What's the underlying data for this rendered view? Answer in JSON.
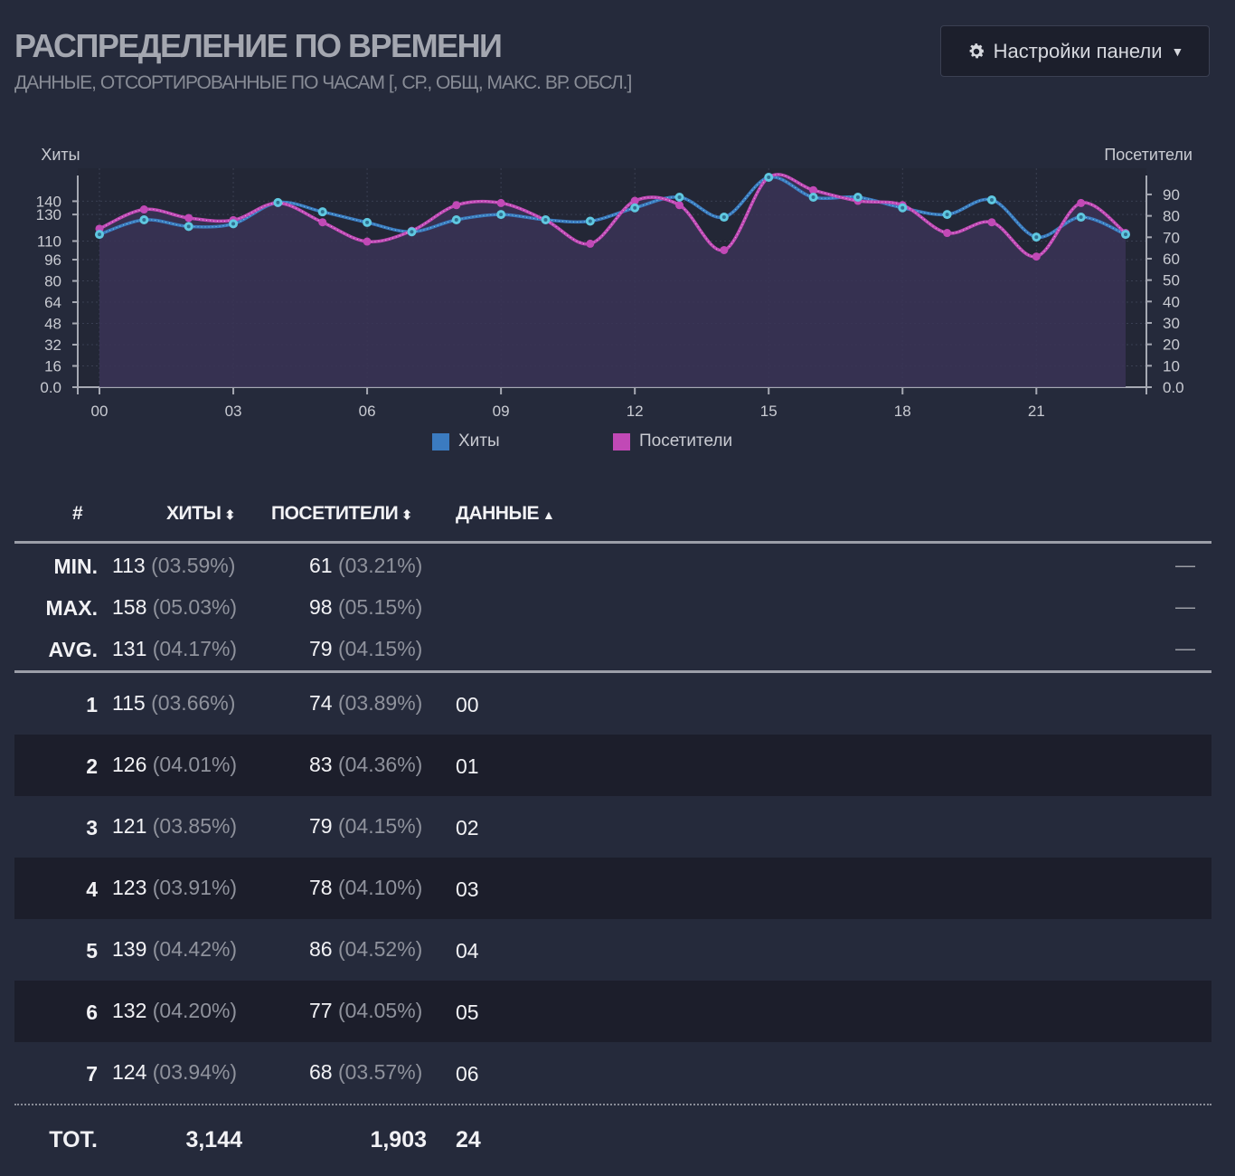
{
  "header": {
    "title": "РАСПРЕДЕЛЕНИЕ ПО ВРЕМЕНИ",
    "subtitle": "ДАННЫЕ, ОТСОРТИРОВАННЫЕ ПО ЧАСАМ [, СР., ОБЩ, МАКС. ВР. ОБСЛ.]",
    "settings_label": "Настройки панели",
    "settings_icon": "gear-icon"
  },
  "chart_data": {
    "type": "line",
    "y_left_label": "Хиты",
    "y_right_label": "Посетители",
    "y_left_ticks": [
      "0.0",
      "16",
      "32",
      "48",
      "64",
      "80",
      "96",
      "110",
      "130",
      "140"
    ],
    "y_right_ticks": [
      "0.0",
      "10",
      "20",
      "30",
      "40",
      "50",
      "60",
      "70",
      "80",
      "90"
    ],
    "y_left_max": 158,
    "y_right_max": 98,
    "x_ticks": [
      "00",
      "03",
      "06",
      "09",
      "12",
      "15",
      "18",
      "21"
    ],
    "x": [
      "00",
      "01",
      "02",
      "03",
      "04",
      "05",
      "06",
      "07",
      "08",
      "09",
      "10",
      "11",
      "12",
      "13",
      "14",
      "15",
      "16",
      "17",
      "18",
      "19",
      "20",
      "21",
      "22",
      "23"
    ],
    "series": [
      {
        "name": "Хиты",
        "color": "#3b7bc0",
        "axis": "left",
        "values": [
          115,
          126,
          121,
          123,
          139,
          132,
          124,
          117,
          126,
          130,
          126,
          125,
          135,
          143,
          128,
          158,
          143,
          143,
          135,
          130,
          141,
          113,
          128,
          115
        ]
      },
      {
        "name": "Посетители",
        "color": "#c149b6",
        "axis": "right",
        "values": [
          74,
          83,
          79,
          78,
          86,
          77,
          68,
          73,
          85,
          86,
          78,
          67,
          87,
          85,
          64,
          98,
          92,
          87,
          85,
          72,
          77,
          61,
          86,
          72
        ]
      }
    ],
    "grid": true,
    "legend_position": "bottom-center"
  },
  "table": {
    "columns": [
      "#",
      "ХИТЫ",
      "ПОСЕТИТЕЛИ",
      "ДАННЫЕ"
    ],
    "summary": [
      {
        "label": "MIN.",
        "hits": "113",
        "hits_pct": "(03.59%)",
        "visitors": "61",
        "visitors_pct": "(03.21%)",
        "dash": "—"
      },
      {
        "label": "MAX.",
        "hits": "158",
        "hits_pct": "(05.03%)",
        "visitors": "98",
        "visitors_pct": "(05.15%)",
        "dash": "—"
      },
      {
        "label": "AVG.",
        "hits": "131",
        "hits_pct": "(04.17%)",
        "visitors": "79",
        "visitors_pct": "(04.15%)",
        "dash": "—"
      }
    ],
    "rows": [
      {
        "num": "1",
        "hits": "115",
        "hits_pct": "(03.66%)",
        "visitors": "74",
        "visitors_pct": "(03.89%)",
        "data": "00"
      },
      {
        "num": "2",
        "hits": "126",
        "hits_pct": "(04.01%)",
        "visitors": "83",
        "visitors_pct": "(04.36%)",
        "data": "01"
      },
      {
        "num": "3",
        "hits": "121",
        "hits_pct": "(03.85%)",
        "visitors": "79",
        "visitors_pct": "(04.15%)",
        "data": "02"
      },
      {
        "num": "4",
        "hits": "123",
        "hits_pct": "(03.91%)",
        "visitors": "78",
        "visitors_pct": "(04.10%)",
        "data": "03"
      },
      {
        "num": "5",
        "hits": "139",
        "hits_pct": "(04.42%)",
        "visitors": "86",
        "visitors_pct": "(04.52%)",
        "data": "04"
      },
      {
        "num": "6",
        "hits": "132",
        "hits_pct": "(04.20%)",
        "visitors": "77",
        "visitors_pct": "(04.05%)",
        "data": "05"
      },
      {
        "num": "7",
        "hits": "124",
        "hits_pct": "(03.94%)",
        "visitors": "68",
        "visitors_pct": "(03.57%)",
        "data": "06"
      }
    ],
    "total": {
      "label": "TOT.",
      "hits": "3,144",
      "visitors": "1,903",
      "data": "24"
    }
  }
}
